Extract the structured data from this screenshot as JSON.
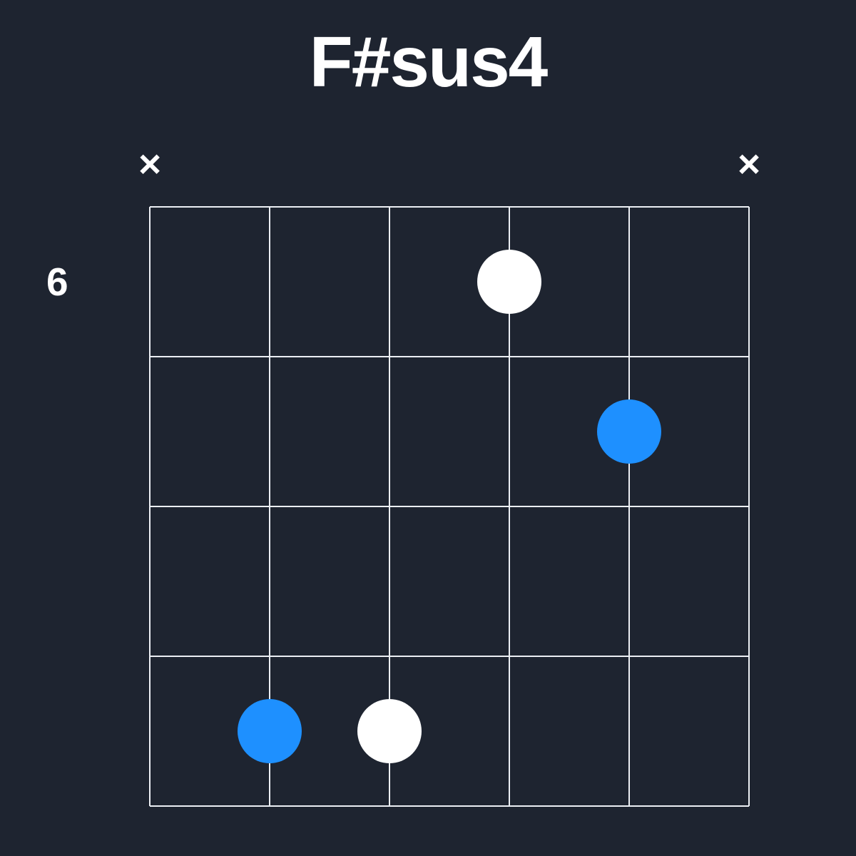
{
  "chord_name": "F#sus4",
  "starting_fret_label": "6",
  "chart_data": {
    "type": "guitar-chord-diagram",
    "title": "F#sus4",
    "strings": 6,
    "frets_shown": 4,
    "starting_fret": 6,
    "string_status": [
      "x",
      null,
      null,
      null,
      null,
      "x"
    ],
    "dots": [
      {
        "string": 2,
        "fret_row": 4,
        "color": "#1e90ff",
        "note": "root-or-highlight"
      },
      {
        "string": 3,
        "fret_row": 4,
        "color": "#ffffff",
        "note": "regular"
      },
      {
        "string": 4,
        "fret_row": 1,
        "color": "#ffffff",
        "note": "regular"
      },
      {
        "string": 5,
        "fret_row": 2,
        "color": "#1e90ff",
        "note": "root-or-highlight"
      }
    ],
    "mute_symbol": "×",
    "colors": {
      "background": "#1e2430",
      "grid": "#eceff4",
      "dot_primary": "#1e90ff",
      "dot_secondary": "#ffffff",
      "text": "#ffffff"
    }
  }
}
